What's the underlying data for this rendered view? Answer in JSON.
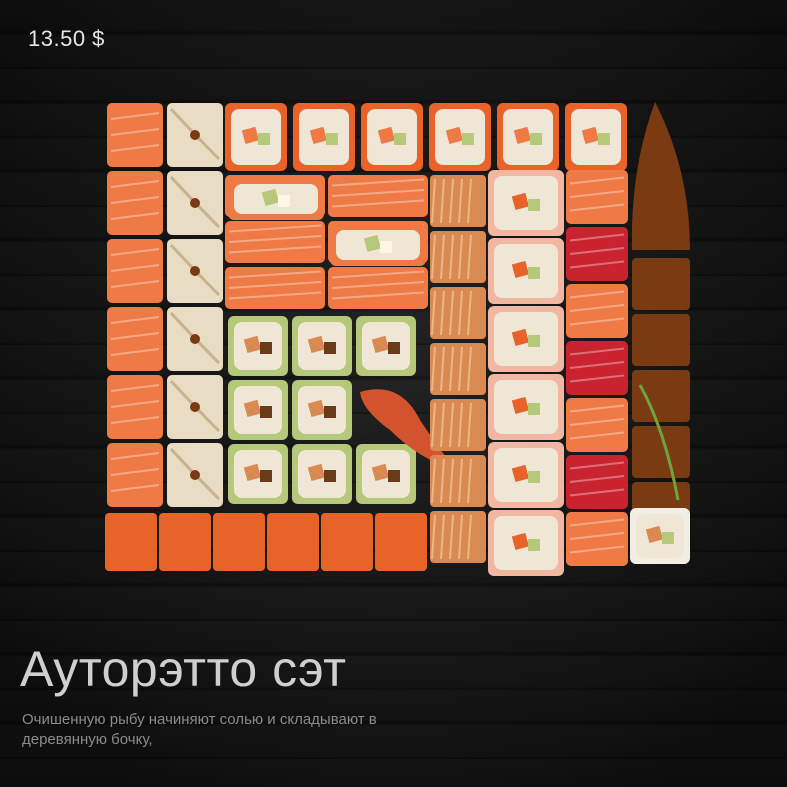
{
  "product": {
    "price": "13.50 $",
    "title": "Ауторэтто сэт",
    "description": "Очишенную рыбу начиняют солью и складывают в деревянную бочку,"
  },
  "photo": {
    "subject": "sushi-set-platter",
    "colors": {
      "salmon": "#f07a45",
      "tuna": "#c8232f",
      "eel": "#7a3a12",
      "rice": "#efe6d6",
      "cucumber": "#b6c97a",
      "tempura": "#d98a52",
      "crab": "#f1b7a3",
      "tobiko": "#e8632a"
    }
  }
}
